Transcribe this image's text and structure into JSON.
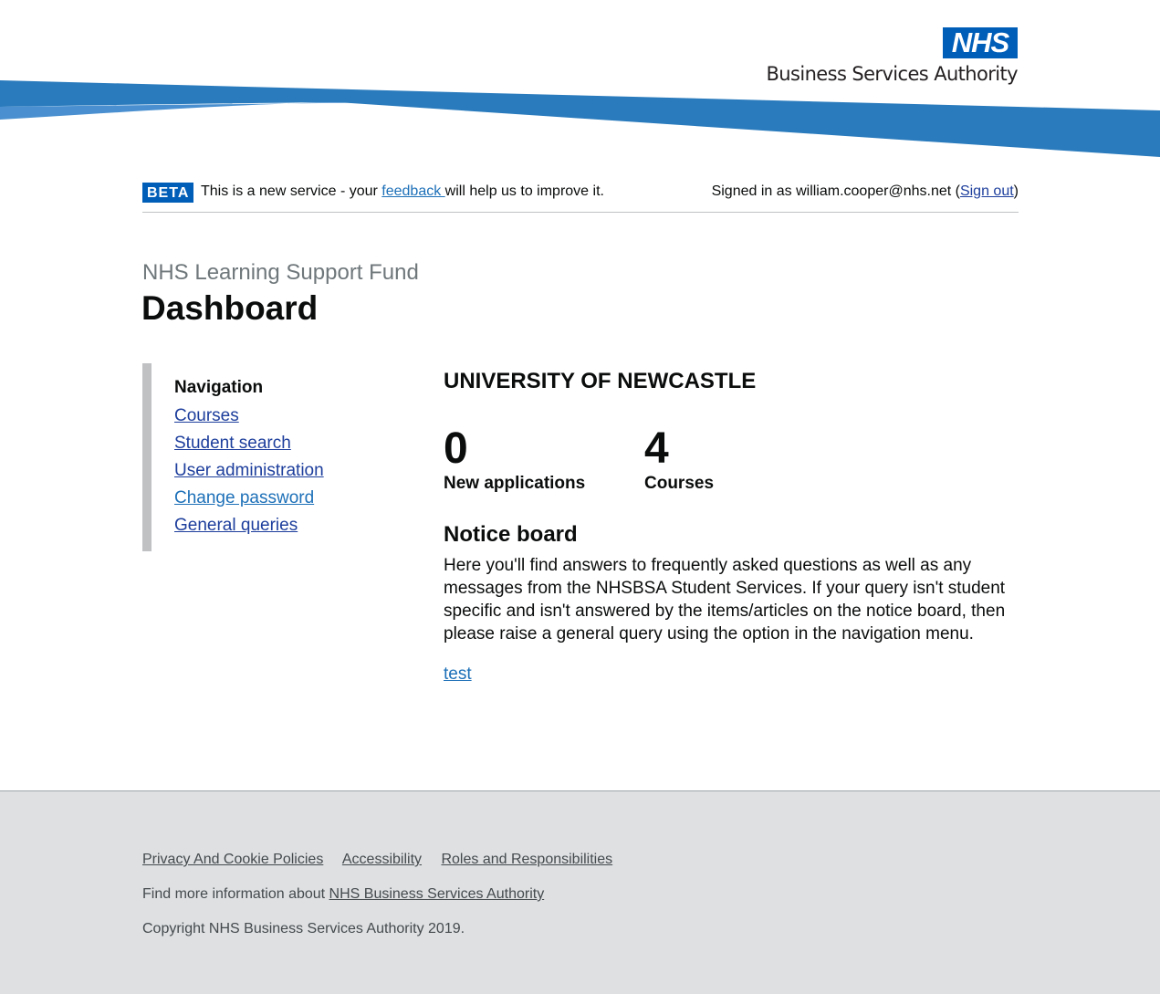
{
  "header": {
    "logo_mark": "NHS",
    "logo_org": "Business Services Authority",
    "colors": {
      "brand_blue": "#005eb8",
      "swoosh_dark": "#2a7bbd",
      "swoosh_light": "#4a90d0"
    }
  },
  "phase_banner": {
    "tag": "BETA",
    "text_before": "This is a new service - your ",
    "feedback_link": "feedback ",
    "text_after": "will help us to improve it.",
    "signed_in_prefix": "Signed in as william.cooper@nhs.net (",
    "sign_out_link": "Sign out",
    "signed_in_suffix": ")"
  },
  "heading": {
    "caption": "NHS Learning Support Fund",
    "title": "Dashboard"
  },
  "sidebar": {
    "title": "Navigation",
    "items": [
      {
        "label": "Courses"
      },
      {
        "label": "Student search"
      },
      {
        "label": "User administration"
      },
      {
        "label": "Change password"
      },
      {
        "label": "General queries"
      }
    ]
  },
  "main": {
    "organisation": "UNIVERSITY OF NEWCASTLE",
    "stats": [
      {
        "value": "0",
        "label": "New applications"
      },
      {
        "value": "4",
        "label": "Courses"
      }
    ],
    "notice_board": {
      "title": "Notice board",
      "body": "Here you'll find answers to frequently asked questions as well as any messages from the NHSBSA Student Services. If your query isn't student specific and isn't answered by the items/articles on the notice board, then please raise a general query using the option in the navigation menu.",
      "link": "test"
    }
  },
  "footer": {
    "links": [
      {
        "label": "Privacy And Cookie Policies"
      },
      {
        "label": "Accessibility"
      },
      {
        "label": "Roles and Responsibilities"
      }
    ],
    "more_prefix": "Find more information about ",
    "more_link": "NHS Business Services Authority",
    "copyright": "Copyright NHS Business Services Authority 2019."
  }
}
